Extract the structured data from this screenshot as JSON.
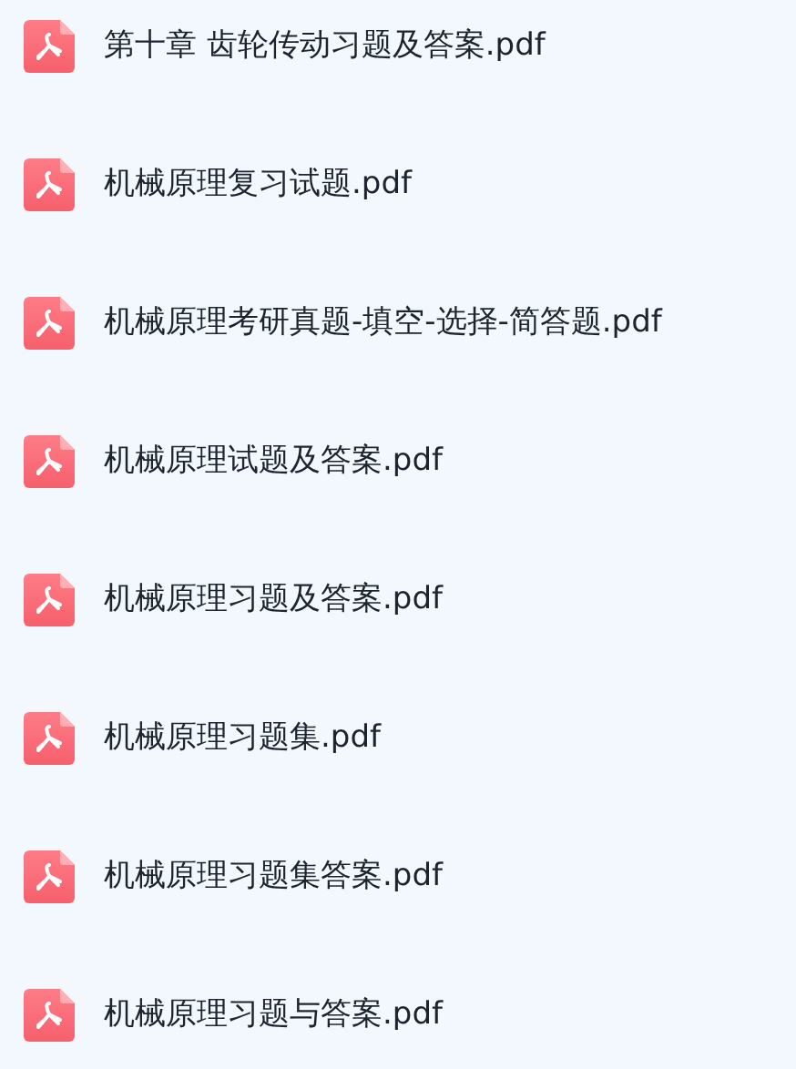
{
  "files": [
    {
      "name": "第十章 齿轮传动习题及答案.pdf"
    },
    {
      "name": "机械原理复习试题.pdf"
    },
    {
      "name": "机械原理考研真题-填空-选择-简答题.pdf"
    },
    {
      "name": "机械原理试题及答案.pdf"
    },
    {
      "name": "机械原理习题及答案.pdf"
    },
    {
      "name": "机械原理习题集.pdf"
    },
    {
      "name": "机械原理习题集答案.pdf"
    },
    {
      "name": "机械原理习题与答案.pdf"
    }
  ]
}
